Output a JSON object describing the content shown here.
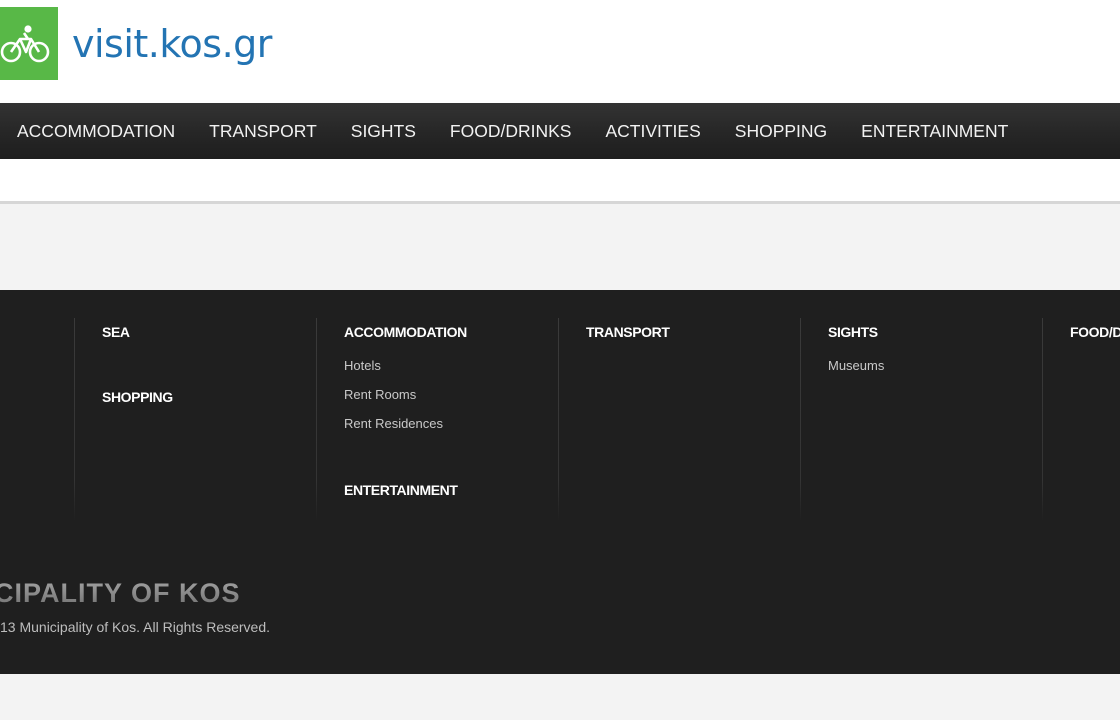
{
  "header": {
    "logo_text": "visit.kos.gr",
    "brand_color": "#58b847",
    "logo_text_color": "#2374b3",
    "logo_icon": "bicycle-icon"
  },
  "nav": {
    "items": [
      {
        "label": "ACCOMMODATION"
      },
      {
        "label": "TRANSPORT"
      },
      {
        "label": "SIGHTS"
      },
      {
        "label": "FOOD/DRINKS"
      },
      {
        "label": "ACTIVITIES"
      },
      {
        "label": "SHOPPING"
      },
      {
        "label": "ENTERTAINMENT"
      }
    ]
  },
  "footer": {
    "columns": [
      {
        "groups": [
          {
            "heading": "SEA",
            "links": []
          },
          {
            "heading": "SHOPPING",
            "links": []
          }
        ]
      },
      {
        "groups": [
          {
            "heading": "ACCOMMODATION",
            "links": [
              "Hotels",
              "Rent Rooms",
              "Rent Residences"
            ]
          },
          {
            "heading": "ENTERTAINMENT",
            "links": []
          }
        ]
      },
      {
        "groups": [
          {
            "heading": "TRANSPORT",
            "links": []
          }
        ]
      },
      {
        "groups": [
          {
            "heading": "SIGHTS",
            "links": [
              "Museums"
            ]
          }
        ]
      },
      {
        "groups": [
          {
            "heading": "FOOD/D",
            "links": []
          }
        ]
      }
    ],
    "municipality_title": "CIPALITY OF KOS",
    "copyright": "13 Municipality of Kos. All Rights Reserved."
  },
  "colors": {
    "nav_background": "#262626",
    "footer_background": "#1f1f1f",
    "page_background": "#f3f3f3"
  }
}
